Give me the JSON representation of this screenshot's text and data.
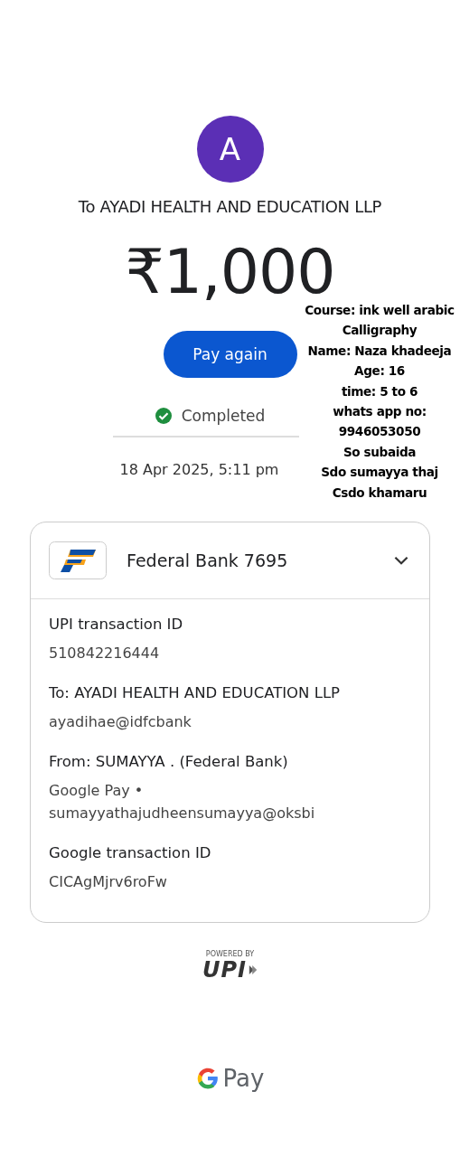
{
  "avatar": {
    "letter": "A"
  },
  "title": "To AYADI HEALTH AND EDUCATION LLP",
  "amount": "₹1,000",
  "button": "Pay again",
  "status": {
    "kind": "completed",
    "label": "Completed"
  },
  "date": "18 Apr 2025, 5:11 pm",
  "note": [
    "Course: ink well arabic",
    "Calligraphy",
    "Name: Naza khadeeja",
    "Age: 16",
    "time: 5 to 6",
    "whats app no:",
    "9946053050",
    "So subaida",
    "Sdo sumayya thaj",
    "Csdo khamaru"
  ],
  "card": {
    "bank": "Federal Bank 7695",
    "expanded": true,
    "details": [
      {
        "label": "UPI transaction ID",
        "value": [
          "510842216444"
        ]
      },
      {
        "label": "To: AYADI HEALTH AND EDUCATION LLP",
        "value": [
          "ayadihae@idfcbank"
        ]
      },
      {
        "label": "From: SUMAYYA . (Federal Bank)",
        "value": [
          "Google Pay •",
          "sumayyathajudheensumayya@oksbi"
        ]
      },
      {
        "label": "Google transaction ID",
        "value": [
          "CICAgMjrv6roFw"
        ]
      }
    ]
  },
  "footer": {
    "powered_by": "POWERED BY",
    "upi": "UPI",
    "brand": "Pay"
  }
}
